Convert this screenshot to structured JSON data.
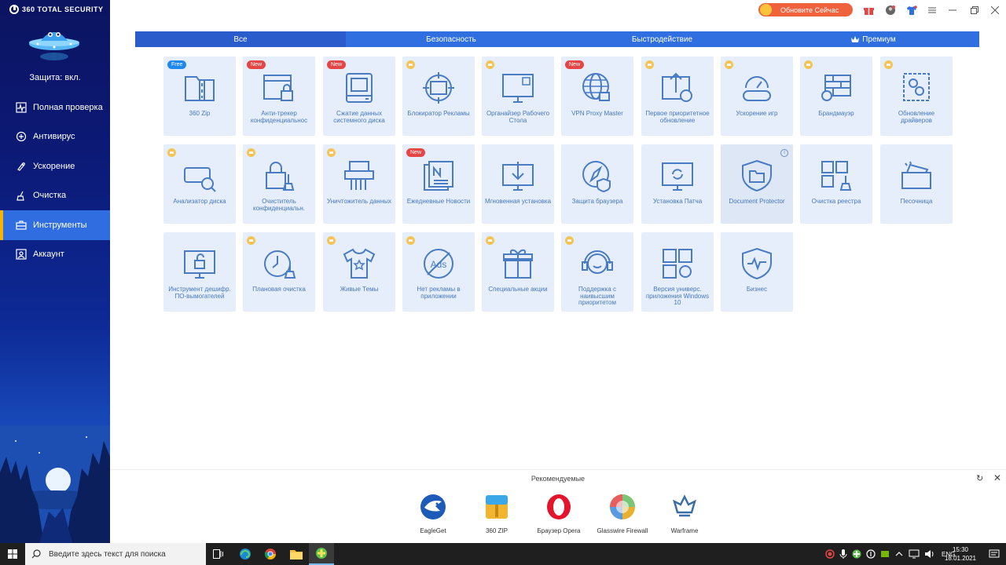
{
  "app": {
    "brand": "360 TOTAL SECURITY",
    "protection_status": "Защита: вкл.",
    "upgrade_label": "Обновите Сейчас"
  },
  "sidebar": {
    "items": [
      {
        "label": "Полная проверка",
        "icon": "pulse-icon",
        "active": false
      },
      {
        "label": "Антивирус",
        "icon": "shield-plus-icon",
        "active": false
      },
      {
        "label": "Ускорение",
        "icon": "rocket-icon",
        "active": false
      },
      {
        "label": "Очистка",
        "icon": "broom-icon",
        "active": false
      },
      {
        "label": "Инструменты",
        "icon": "toolbox-icon",
        "active": true
      },
      {
        "label": "Аккаунт",
        "icon": "account-icon",
        "active": false
      }
    ]
  },
  "tabs": [
    {
      "label": "Все",
      "active": true
    },
    {
      "label": "Безопасность",
      "active": false
    },
    {
      "label": "Быстродействие",
      "active": false
    },
    {
      "label": "Премиум",
      "active": false,
      "icon": "crown-icon"
    }
  ],
  "tools": [
    {
      "label": "360 Zip",
      "badge": "Free",
      "icon": "zip-icon"
    },
    {
      "label": "Анти-трекер конфиденциальнос",
      "badge": "New",
      "icon": "lock-window-icon"
    },
    {
      "label": "Сжатие данных системного диска",
      "badge": "New",
      "icon": "disk-compress-icon"
    },
    {
      "label": "Блокиратор Рекламы",
      "badge": "crown",
      "icon": "target-icon"
    },
    {
      "label": "Органайзер Рабочего Стола",
      "badge": "crown",
      "icon": "monitor-grid-icon"
    },
    {
      "label": "VPN Proxy Master",
      "badge": "New",
      "icon": "globe-lock-icon"
    },
    {
      "label": "Первое приоритетное обновление",
      "badge": "crown",
      "icon": "upload-refresh-icon"
    },
    {
      "label": "Ускорение игр",
      "badge": "crown",
      "icon": "gamepad-gauge-icon"
    },
    {
      "label": "Брандмауэр",
      "badge": "crown",
      "icon": "firewall-icon"
    },
    {
      "label": "Обновление драйверов",
      "badge": "crown",
      "icon": "gear-chip-icon"
    },
    {
      "label": "Анализатор диска",
      "badge": "crown",
      "icon": "disk-magnifier-icon"
    },
    {
      "label": "Очиститель конфиденциальн.",
      "badge": "crown",
      "icon": "lock-broom-icon"
    },
    {
      "label": "Уничтожитель данных",
      "badge": "crown",
      "icon": "shredder-icon"
    },
    {
      "label": "Ежедневные Новости",
      "badge": "New",
      "icon": "news-icon"
    },
    {
      "label": "Мгновенная установка",
      "badge": "",
      "icon": "download-monitor-icon"
    },
    {
      "label": "Защита браузера",
      "badge": "",
      "icon": "compass-shield-icon"
    },
    {
      "label": "Установка Патча",
      "badge": "",
      "icon": "monitor-refresh-icon"
    },
    {
      "label": "Document Protector",
      "badge": "",
      "icon": "folder-shield-icon",
      "info": "i"
    },
    {
      "label": "Очистка реестра",
      "badge": "",
      "icon": "registry-broom-icon"
    },
    {
      "label": "Песочница",
      "badge": "",
      "icon": "sandbox-icon"
    },
    {
      "label": "Инструмент дешифр. ПО-вымогателей",
      "badge": "",
      "icon": "unlock-monitor-icon"
    },
    {
      "label": "Плановая очистка",
      "badge": "crown",
      "icon": "clock-broom-icon"
    },
    {
      "label": "Живые Темы",
      "badge": "crown",
      "icon": "tshirt-icon"
    },
    {
      "label": "Нет рекламы в приложении",
      "badge": "crown",
      "icon": "ads-icon"
    },
    {
      "label": "Специальные акции",
      "badge": "crown",
      "icon": "gift-icon"
    },
    {
      "label": "Поддержка с наивысшим приоритетом",
      "badge": "crown",
      "icon": "headset-icon"
    },
    {
      "label": "Версия универс. приложения Windows 10",
      "badge": "",
      "icon": "windows-app-icon"
    },
    {
      "label": "Бизнес",
      "badge": "",
      "icon": "business-shield-icon"
    }
  ],
  "recommended": {
    "title": "Рекомендуемые",
    "apps": [
      {
        "label": "EagleGet",
        "icon": "eagleget-icon",
        "color": "#1e5bb8"
      },
      {
        "label": "360 ZIP",
        "icon": "zip360-icon",
        "color": "#f2b531"
      },
      {
        "label": "Браузер Opera",
        "icon": "opera-icon",
        "color": "#e3142b"
      },
      {
        "label": "Glasswire Firewall",
        "icon": "glasswire-icon",
        "color": "#e8b030"
      },
      {
        "label": "Warframe",
        "icon": "warframe-icon",
        "color": "#3b6ea5"
      }
    ]
  },
  "taskbar": {
    "search_placeholder": "Введите здесь текст для поиска",
    "language": "ENG",
    "time": "15:30",
    "date": "18.01.2021"
  },
  "colors": {
    "accent": "#2f6fe0",
    "tile_bg": "#e5eefa",
    "tile_text": "#4778c4",
    "badge_new": "#e64545",
    "badge_free": "#1e88ee",
    "crown": "#f6c451",
    "upgrade": "#f0623c"
  }
}
